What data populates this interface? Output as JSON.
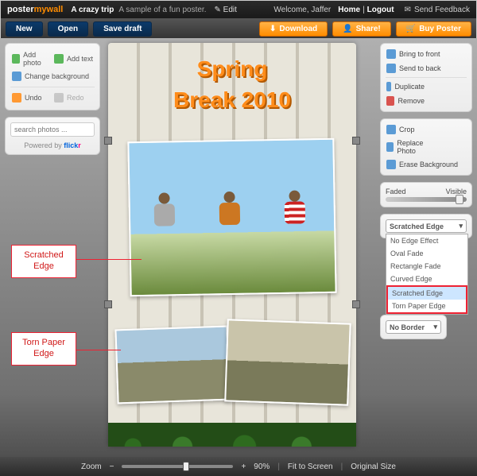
{
  "header": {
    "brand_a": "poster",
    "brand_b": "mywall",
    "doc_title": "A crazy trip",
    "doc_subtitle": "A sample of a fun poster.",
    "edit_label": "Edit",
    "welcome": "Welcome, Jaffer",
    "home": "Home",
    "logout": "Logout",
    "feedback": "Send Feedback"
  },
  "actions": {
    "new": "New",
    "open": "Open",
    "save": "Save draft",
    "download": "Download",
    "share": "Share!",
    "buy": "Buy Poster"
  },
  "left_panel": {
    "add_photo": "Add photo",
    "add_text": "Add text",
    "change_bg": "Change background",
    "undo": "Undo",
    "redo": "Redo",
    "search_placeholder": "search photos ...",
    "powered": "Powered by",
    "flickr": "flickr"
  },
  "right_panel": {
    "bring_front": "Bring to front",
    "send_back": "Send to back",
    "duplicate": "Duplicate",
    "remove": "Remove",
    "crop": "Crop",
    "replace": "Replace Photo",
    "erase_bg": "Erase Background",
    "faded": "Faded",
    "visible": "Visible",
    "edge_selected": "Scratched Edge",
    "edge_options": [
      "No Edge Effect",
      "Oval Fade",
      "Rectangle Fade",
      "Curved Edge",
      "Scratched Edge",
      "Torn Paper Edge"
    ],
    "border_selected": "No Border"
  },
  "poster": {
    "line1": "Spring",
    "line2": "Break 2010"
  },
  "callouts": {
    "scratched": "Scratched\nEdge",
    "torn": "Torn Paper\nEdge"
  },
  "bottom": {
    "zoom_label": "Zoom",
    "zoom_value": "90%",
    "fit": "Fit to Screen",
    "original": "Original Size"
  }
}
